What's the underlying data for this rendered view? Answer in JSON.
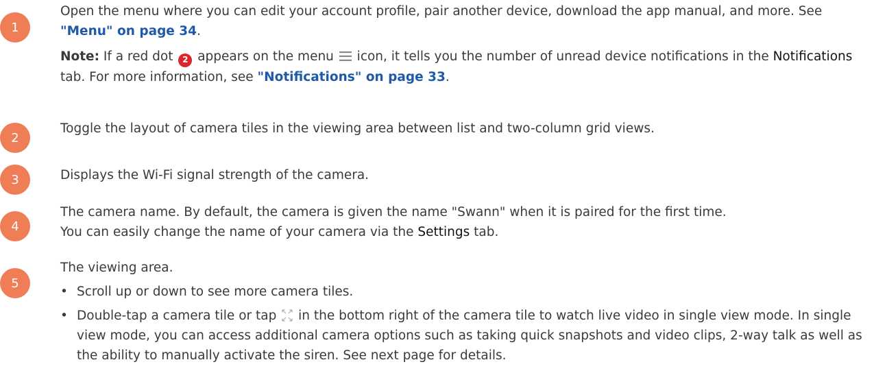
{
  "items": [
    {
      "number": "1",
      "text_before_link": "Open the menu where you can edit your account profile, pair another device, download the app manual, and more. See ",
      "link": "\"Menu\" on page 34",
      "text_after_link": ".",
      "note": {
        "label": "Note:",
        "text_1": " If a red dot ",
        "dot_number": "2",
        "text_2": " appears on the menu ",
        "text_3": " icon, it tells you the number of unread device notifications in the ",
        "tab_name": "Notifications",
        "text_4": " tab. For more information, see ",
        "link": "\"Notifications\" on page 33",
        "text_5": "."
      }
    },
    {
      "number": "2",
      "text": "Toggle the layout of camera tiles in the viewing area between list and two-column grid views."
    },
    {
      "number": "3",
      "text": "Displays the Wi-Fi signal strength of the camera."
    },
    {
      "number": "4",
      "line1": "The camera name. By default, the camera is given the name \"Swann\" when it is paired for the first time.",
      "line2_before": "You can easily change the name of your camera  via the ",
      "tab_name": "Settings",
      "line2_after": " tab."
    },
    {
      "number": "5",
      "text": "The viewing area.",
      "bullets": [
        {
          "text": "Scroll up or down to see more camera tiles."
        },
        {
          "before_icon": "Double-tap a camera tile or tap ",
          "icon": "expand-icon",
          "after_icon": " in the bottom right of the camera tile to watch live video in single view mode. In single view mode, you can access additional camera options such as taking quick snapshots and video clips, 2-way talk as well as the ability to manually activate the siren. See next page for details."
        }
      ]
    }
  ],
  "colors": {
    "badge": "#ef7e56",
    "link": "#1e5aa8",
    "red_dot": "#d9262b",
    "text": "#3a3a3a"
  }
}
